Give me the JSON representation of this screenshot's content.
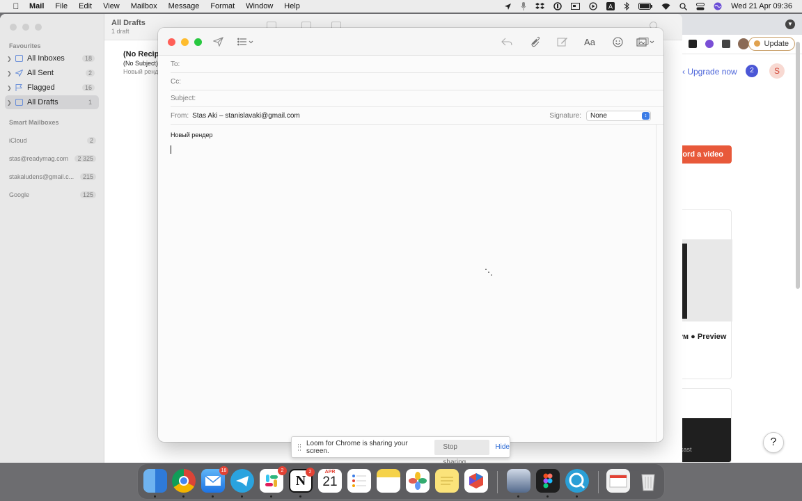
{
  "menubar": {
    "app_name": "Mail",
    "menus": [
      "File",
      "Edit",
      "View",
      "Mailbox",
      "Message",
      "Format",
      "Window",
      "Help"
    ],
    "clock": "Wed 21 Apr  09:36"
  },
  "sidebar": {
    "favourites_heading": "Favourites",
    "items": [
      {
        "label": "All Inboxes",
        "count": "18"
      },
      {
        "label": "All Sent",
        "count": "2"
      },
      {
        "label": "Flagged",
        "count": "16"
      },
      {
        "label": "All Drafts",
        "count": "1"
      }
    ],
    "smart_heading": "Smart Mailboxes",
    "accounts": [
      {
        "label": "iCloud",
        "count": "2"
      },
      {
        "label": "stas@readymag.com",
        "count": "2 325"
      },
      {
        "label": "stakaludens@gmail.c...",
        "count": "215"
      },
      {
        "label": "Google",
        "count": "125"
      }
    ]
  },
  "message_list": {
    "title": "All Drafts",
    "subtitle": "1 draft",
    "row": {
      "recipient": "(No Recip",
      "subject": "(No Subject)",
      "preview": "Новый ренд"
    }
  },
  "compose": {
    "to_label": "To:",
    "cc_label": "Cc:",
    "subject_label": "Subject:",
    "from_label": "From:",
    "from_value": "Stas Aki – stanislavaki@gmail.com",
    "signature_label": "Signature:",
    "signature_value": "None",
    "body_text": "Новый рендер",
    "font_button": "Aa"
  },
  "loom": {
    "message": "Loom for Chrome is sharing your screen.",
    "stop_label": "Stop sharing",
    "hide_label": "Hide"
  },
  "chrome": {
    "update_label": "Update",
    "upgrade_link": "Upgrade now",
    "notif_count": "2",
    "avatar_letter": "S",
    "record_button": "cord a video",
    "card_caption": "ум ● Preview",
    "card2_text": "cast",
    "help_label": "?"
  },
  "dock": {
    "mail_badge": "18",
    "slack_badge": "2",
    "notion_badge": "2",
    "calendar_month": "APR",
    "calendar_day": "21"
  },
  "colors": {
    "close": "#ff5f57",
    "minimize": "#febc2e",
    "zoom": "#28c840",
    "accent_blue": "#3b7ce6",
    "loom_orange": "#e8593a"
  }
}
